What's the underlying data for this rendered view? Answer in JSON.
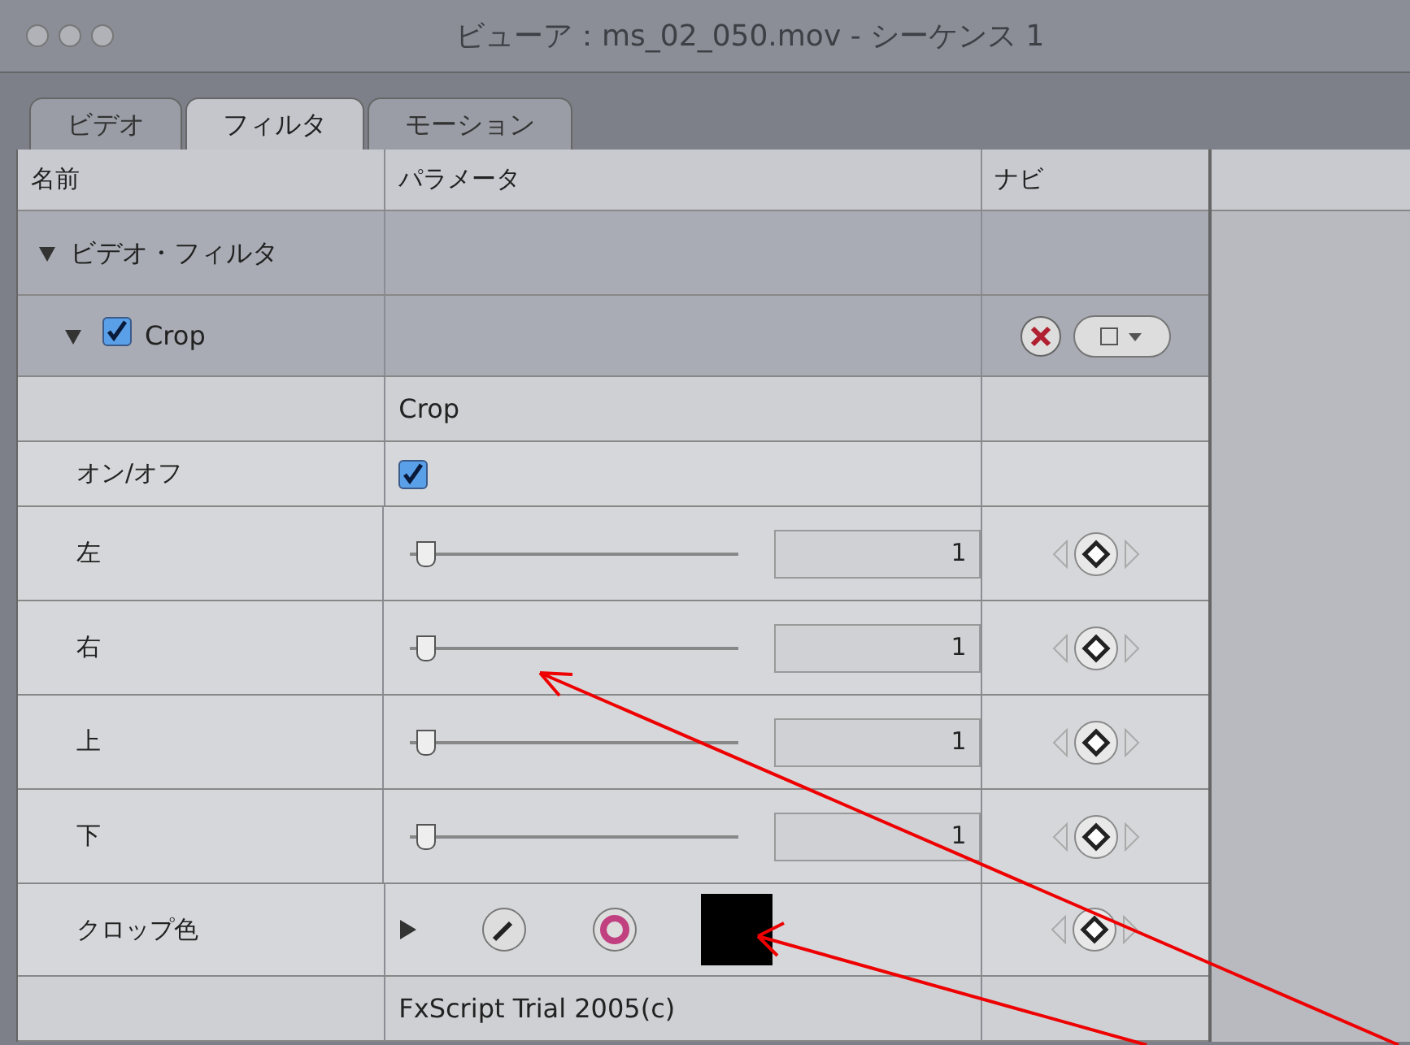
{
  "window": {
    "title": "ビューア：ms_02_050.mov - シーケンス 1"
  },
  "tabs": [
    {
      "label": "ビデオ",
      "selected": false
    },
    {
      "label": "フィルタ",
      "selected": true
    },
    {
      "label": "モーション",
      "selected": false
    }
  ],
  "columns": [
    "名前",
    "パラメータ",
    "ナビ"
  ],
  "rows": [
    {
      "kind": "group",
      "name": "ビデオ・フィルタ",
      "expanded": true
    },
    {
      "kind": "filter",
      "name": "Crop",
      "expanded": true,
      "checked": true
    },
    {
      "kind": "title",
      "text": "Crop"
    },
    {
      "kind": "checkbox",
      "name": "オン/オフ",
      "checked": true
    },
    {
      "kind": "slider",
      "name": "左",
      "level": 0.03,
      "value": "1"
    },
    {
      "kind": "slider",
      "name": "右",
      "level": 0.03,
      "value": "1"
    },
    {
      "kind": "slider",
      "name": "上",
      "level": 0.03,
      "value": "1"
    },
    {
      "kind": "slider",
      "name": "下",
      "level": 0.03,
      "value": "1"
    },
    {
      "kind": "color",
      "name": "クロップ色",
      "color": "#000000"
    },
    {
      "kind": "title",
      "text": "FxScript Trial 2005(c)"
    }
  ]
}
